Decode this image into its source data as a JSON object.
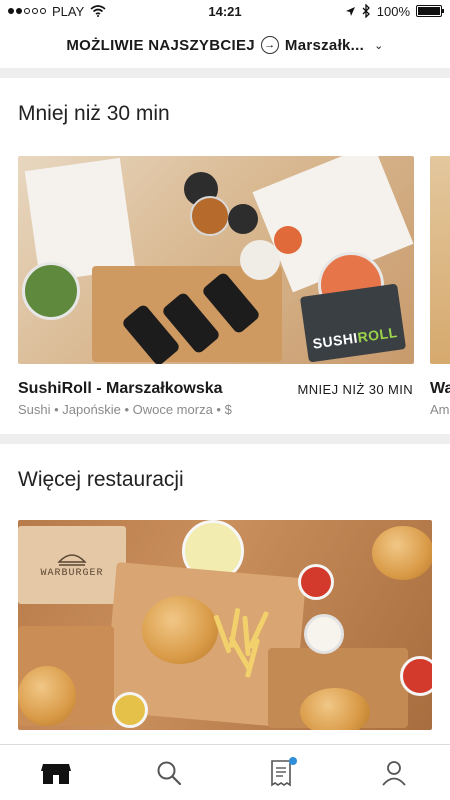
{
  "status_bar": {
    "carrier": "PLAY",
    "time": "14:21",
    "battery": "100%",
    "battery_level": 1.0
  },
  "header": {
    "delivery_label": "MOŻLIWIE NAJSZYBCIEJ",
    "location_label": "Marszałk..."
  },
  "sections": {
    "fast": {
      "title": "Mniej niż 30 min",
      "card": {
        "name": "SushiRoll - Marszałkowska",
        "time": "MNIEJ NIŻ 30 MIN",
        "tags": "Sushi • Japońskie • Owoce morza • $",
        "brand_text_a": "SUSHI",
        "brand_text_b": "ROLL"
      },
      "peek_card": {
        "name": "Wa",
        "tags": "Am"
      }
    },
    "more": {
      "title": "Więcej restauracji",
      "card": {
        "brand_text": "WARBURGER"
      }
    }
  },
  "tabs": [
    {
      "icon": "store-icon"
    },
    {
      "icon": "search-icon"
    },
    {
      "icon": "orders-icon",
      "has_notification": true
    },
    {
      "icon": "profile-icon"
    }
  ],
  "colors": {
    "accent": "#2f8fd8",
    "brand_green": "#9ad34a"
  }
}
